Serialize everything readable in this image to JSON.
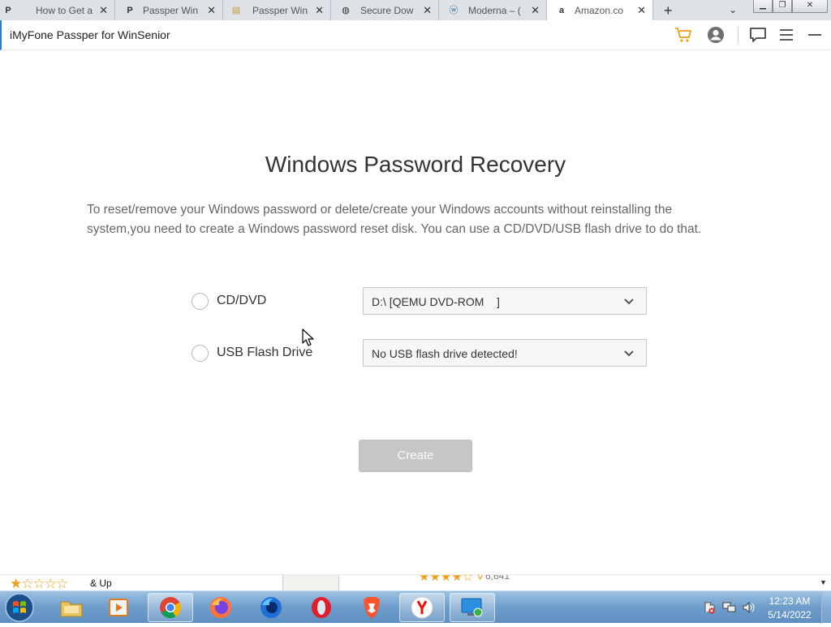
{
  "browser_tabs": [
    {
      "title": "How to Get a",
      "icon": "passper-icon"
    },
    {
      "title": "Passper Win",
      "icon": "passper-icon"
    },
    {
      "title": "Passper Win",
      "icon": "document-icon"
    },
    {
      "title": "Secure Dow",
      "icon": "globe-icon"
    },
    {
      "title": "Moderna – (",
      "icon": "wordpress-icon"
    },
    {
      "title": "Amazon.co",
      "icon": "amazon-icon"
    }
  ],
  "app": {
    "title": "iMyFone Passper for WinSenior",
    "accent": "#2d7bd9",
    "cart_color": "#f39c12"
  },
  "main": {
    "title": "Windows Password Recovery",
    "description": "To reset/remove your Windows password or delete/create your Windows accounts without reinstalling the system,you need to create a Windows password reset disk. You can use a CD/DVD/USB flash drive to do that.",
    "options": [
      {
        "label": "CD/DVD",
        "selected_value": "D:\\ [QEMU DVD-ROM    ]"
      },
      {
        "label": "USB Flash Drive",
        "selected_value": "No USB flash drive detected!"
      }
    ],
    "create_label": "Create"
  },
  "underlay": {
    "and_up": "& Up",
    "rating_count": "6,641"
  },
  "taskbar": {
    "time": "12:23 AM",
    "date": "5/14/2022"
  }
}
